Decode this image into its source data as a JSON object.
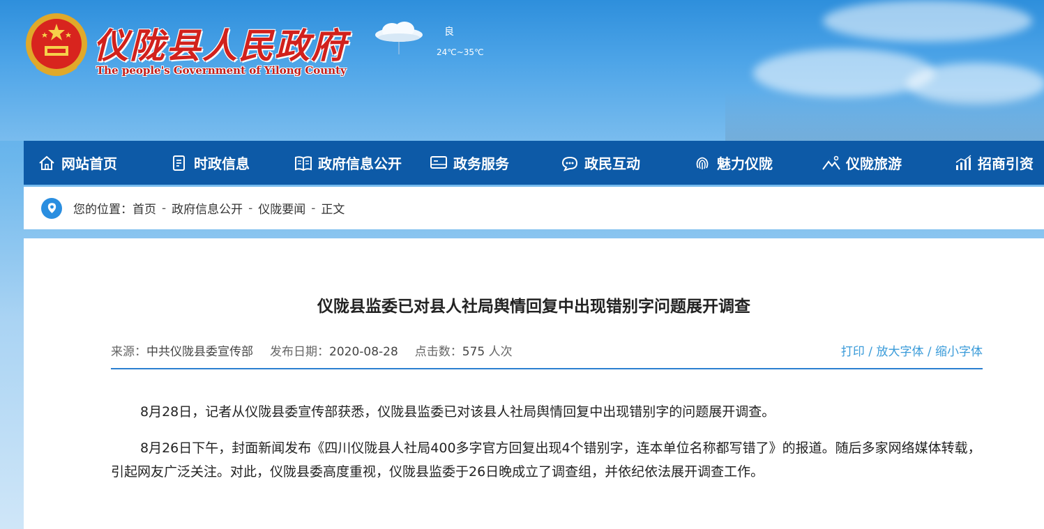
{
  "header": {
    "title": "仪陇县人民政府",
    "subtitle": "The people's Government of Yilong County",
    "weather": {
      "air_quality": "良",
      "temperature": "24℃~35℃",
      "icon": "cloud-icon"
    }
  },
  "nav": {
    "items": [
      {
        "label": "网站首页",
        "icon": "home-icon"
      },
      {
        "label": "时政信息",
        "icon": "document-icon"
      },
      {
        "label": "政府信息公开",
        "icon": "book-icon"
      },
      {
        "label": "政务服务",
        "icon": "monitor-icon"
      },
      {
        "label": "政民互动",
        "icon": "chat-icon"
      },
      {
        "label": "魅力仪陇",
        "icon": "fingerprint-icon"
      },
      {
        "label": "仪陇旅游",
        "icon": "mountain-icon"
      },
      {
        "label": "招商引资",
        "icon": "chart-icon"
      }
    ]
  },
  "breadcrumb": {
    "prefix": "您的位置：",
    "items": [
      "首页",
      "政府信息公开",
      "仪陇要闻",
      "正文"
    ],
    "separator": "-"
  },
  "article": {
    "title": "仪陇县监委已对县人社局舆情回复中出现错别字问题展开调查",
    "meta": {
      "source_label": "来源：",
      "source": "中共仪陇县委宣传部",
      "date_label": "发布日期：",
      "date": "2020-08-28",
      "clicks_label": "点击数：",
      "clicks": "575",
      "clicks_unit": "人次"
    },
    "tools": {
      "print": "打印",
      "enlarge": "放大字体",
      "shrink": "缩小字体",
      "separator": " / "
    },
    "paragraphs": [
      "8月28日，记者从仪陇县委宣传部获悉，仪陇县监委已对该县人社局舆情回复中出现错别字的问题展开调查。",
      "8月26日下午，封面新闻发布《四川仪陇县人社局400多字官方回复出现4个错别字，连本单位名称都写错了》的报道。随后多家网络媒体转载，引起网友广泛关注。对此，仪陇县委高度重视，仪陇县监委于26日晚成立了调查组，并依纪依法展开调查工作。"
    ]
  },
  "colors": {
    "nav_bg": "#0d5aa7",
    "title_red": "#d1211c",
    "link_blue": "#3a9bd9",
    "rule_blue": "#2b7fd0"
  }
}
